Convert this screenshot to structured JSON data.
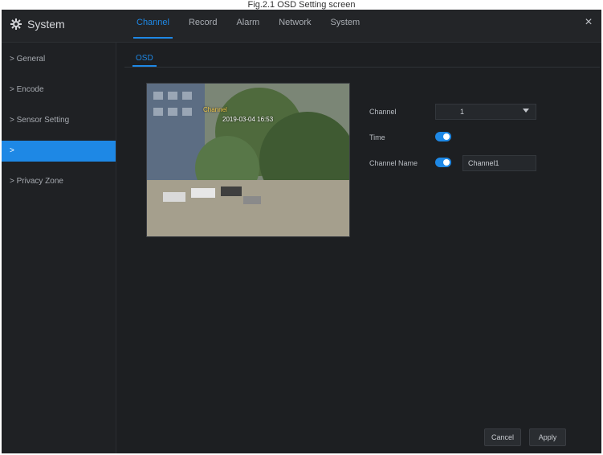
{
  "caption": "Fig.2.1 OSD Setting screen",
  "app": {
    "title": "System",
    "close_label": "×",
    "tabs": [
      {
        "label": "Channel",
        "active": true
      },
      {
        "label": "Record",
        "active": false
      },
      {
        "label": "Alarm",
        "active": false
      },
      {
        "label": "Network",
        "active": false
      },
      {
        "label": "System",
        "active": false
      }
    ]
  },
  "sidebar": {
    "items": [
      {
        "label": "> General",
        "active": false
      },
      {
        "label": "> Encode",
        "active": false
      },
      {
        "label": "> Sensor Setting",
        "active": false
      },
      {
        "label": ">",
        "active": true
      },
      {
        "label": "> Privacy Zone",
        "active": false
      }
    ]
  },
  "subtab": {
    "label": "OSD"
  },
  "preview": {
    "osd_name": "Channel",
    "osd_time": "2019-03-04 16:53"
  },
  "form": {
    "channel": {
      "label": "Channel",
      "value": "1"
    },
    "time": {
      "label": "Time",
      "enabled": true
    },
    "channel_name": {
      "label": "Channel Name",
      "enabled": true,
      "value": "Channel1"
    }
  },
  "buttons": {
    "cancel": "Cancel",
    "apply": "Apply"
  },
  "colors": {
    "accent": "#1e88e5",
    "background": "#1d1f22",
    "sidebar": "#1f2124"
  }
}
